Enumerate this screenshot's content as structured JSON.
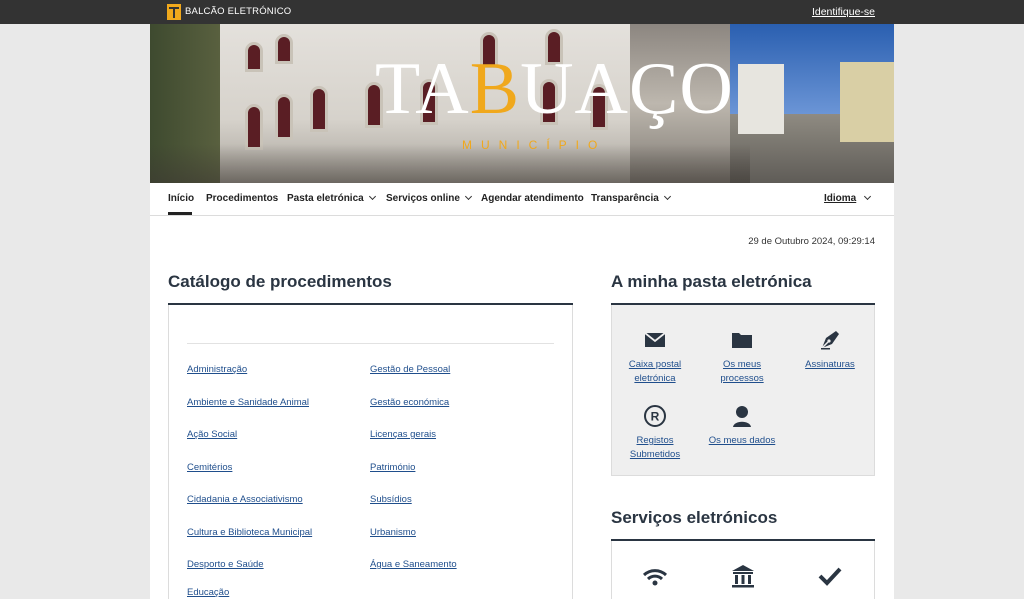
{
  "topbar": {
    "brand": "BALCÃO ELETRÓNICO",
    "login": "Identifique-se"
  },
  "hero": {
    "wordmark_pre": "TA",
    "wordmark_accent": "B",
    "wordmark_post": "UAÇO",
    "subtitle": "MUNICÍPIO",
    "accent_color": "#f0a81c"
  },
  "nav": {
    "items": [
      {
        "label": "Início",
        "dropdown": false,
        "active": true
      },
      {
        "label": "Procedimentos",
        "dropdown": false
      },
      {
        "label": "Pasta eletrónica",
        "dropdown": true
      },
      {
        "label": "Serviços online",
        "dropdown": true
      },
      {
        "label": "Agendar atendimento",
        "dropdown": false
      },
      {
        "label": "Transparência",
        "dropdown": true
      }
    ],
    "language": "Idioma"
  },
  "datetime": "29 de Outubro 2024, 09:29:14",
  "catalog": {
    "title": "Catálogo de procedimentos",
    "col1": [
      "Administração",
      "Ambiente e Sanidade Animal",
      "Ação Social",
      "Cemitérios",
      "Cidadania e Associativismo",
      "Cultura e Biblioteca Municipal",
      "Desporto e Saúde",
      "Educação"
    ],
    "col2": [
      "Gestão de Pessoal",
      "Gestão económica",
      "Licenças gerais",
      "Património",
      "Subsídios",
      "Urbanismo",
      "Água e Saneamento"
    ]
  },
  "pasta": {
    "title": "A minha pasta eletrónica",
    "tiles": [
      {
        "icon": "envelope-icon",
        "label1": "Caixa postal",
        "label2": "eletrónica"
      },
      {
        "icon": "folder-icon",
        "label1": "Os meus",
        "label2": "processos"
      },
      {
        "icon": "pen-nib-icon",
        "label1": "Assinaturas",
        "label2": ""
      },
      {
        "icon": "registered-icon",
        "label1": "Registos",
        "label2": "Submetidos"
      },
      {
        "icon": "user-icon",
        "label1": "Os meus dados",
        "label2": ""
      }
    ]
  },
  "services": {
    "title": "Serviços eletrónicos",
    "icons": [
      "wifi-icon",
      "bank-icon",
      "checkmark-icon"
    ]
  },
  "colors": {
    "topbar": "#333333",
    "link": "#1f4e8c",
    "heading": "#2a3542"
  }
}
